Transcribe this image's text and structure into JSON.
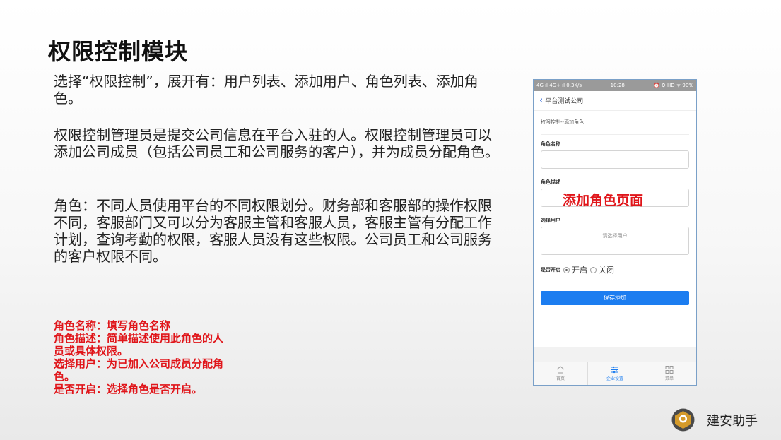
{
  "title": "权限控制模块",
  "paragraphs": [
    "选择“权限控制”，展开有：用户列表、添加用户、角色列表、添加角色。",
    "权限控制管理员是提交公司信息在平台入驻的人。权限控制管理员可以添加公司成员（包括公司员工和公司服务的客户），并为成员分配角色。",
    "角色：不同人员使用平台的不同权限划分。财务部和客服部的操作权限不同，客服部门又可以分为客服主管和客服人员，客服主管有分配工作计划，查询考勤的权限，客服人员没有这些权限。公司员工和公司服务的客户权限不同。"
  ],
  "notes": [
    "角色名称：填写角色名称",
    "角色描述：简单描述使用此角色的人员或具体权限。",
    "选择用户：为已加入公司成员分配角色。",
    "是否开启：选择角色是否开启。"
  ],
  "phone": {
    "status_left": "4G ıl 4G+ ıl 0.3K/s",
    "status_time": "10:28",
    "status_right": "⏰ ⚙ HD ᯤ 90%",
    "nav_title": "平台测试公司",
    "breadcrumb": "权限控制--添加角色",
    "role_name_label": "角色名称",
    "role_desc_label": "角色描述",
    "overlay_text": "添加角色页面",
    "select_user_label": "选择用户",
    "select_user_placeholder": "请选择用户",
    "enable_label": "是否开启",
    "enable_on": "开启",
    "enable_off": "关闭",
    "enabled": true,
    "save_button": "保存添加",
    "tabs": [
      {
        "label": "首页",
        "icon": "home-icon",
        "active": false
      },
      {
        "label": "企业设置",
        "icon": "settings-sliders-icon",
        "active": true
      },
      {
        "label": "菜单",
        "icon": "grid-menu-icon",
        "active": false
      }
    ]
  },
  "brand": {
    "name": "建安助手"
  },
  "colors": {
    "accent": "#1c7df0",
    "highlight": "#e0151a"
  }
}
